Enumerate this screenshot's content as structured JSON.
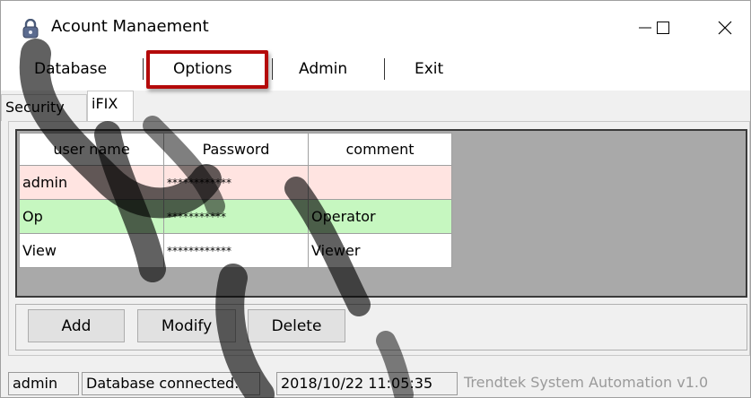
{
  "window": {
    "title": "Acount Manaement",
    "icon": "padlock-icon",
    "minimize_glyph": "—",
    "maximize_glyph": "☐",
    "close_glyph": "✕"
  },
  "menu": {
    "items": [
      "Database",
      "Options",
      "Admin",
      "Exit"
    ],
    "highlighted": "Options",
    "highlight_color": "#b40a0a"
  },
  "tabs": [
    "Security",
    "iFIX"
  ],
  "active_tab": "iFIX",
  "grid": {
    "columns": [
      "user name",
      "Password",
      "comment"
    ],
    "rows": [
      {
        "user": "admin",
        "password": "************",
        "comment": "",
        "bg": "#ffe4e1"
      },
      {
        "user": "Op",
        "password": "***********",
        "comment": "Operator",
        "bg": "#c6f7c0"
      },
      {
        "user": "View",
        "password": "************",
        "comment": "Viewer",
        "bg": "#ffffff"
      }
    ]
  },
  "buttons": {
    "add": "Add",
    "modify": "Modify",
    "delete": "Delete"
  },
  "status": {
    "user": "admin",
    "db_state": "Database connected.",
    "datetime": "2018/10/22 11:05:35",
    "product": "Trendtek System Automation v1.0"
  },
  "watermark_color": "#000000"
}
